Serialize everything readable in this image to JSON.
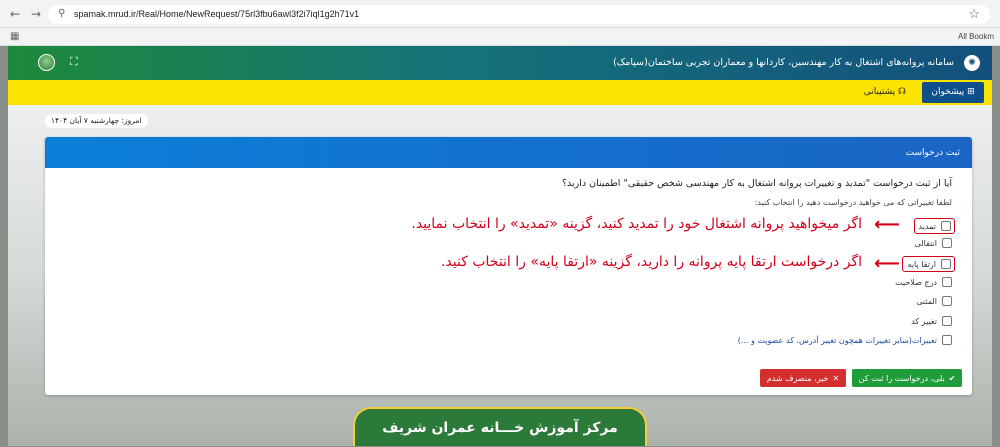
{
  "browser": {
    "url": "spamak.mrud.ir/Real/Home/NewRequest/75rl3fbu6awl3f2i7iql1g2h71v1",
    "bookmarks_label": "All Bookm"
  },
  "header": {
    "title": "سامانه پروانه‌های اشتغال به کار مهندسین، کاردانها و معماران تجربی ساختمان(سپامک)"
  },
  "toolbar": {
    "dashboard_label": "پیشخوان",
    "support_label": "پشتیبانی"
  },
  "date_text": "امروز: چهارشنبه ۷ آبان ۱۴۰۴",
  "card": {
    "title": "ثبت درخواست",
    "question": "آیا از ثبت درخواست \"تمدید و تغییرات پروانه اشتغال به کار مهندسی شخص حقیقی\" اطمینان دارید؟",
    "instruction": "لطفا تغییراتی که می خواهید درخواست دهید را انتخاب کنید:",
    "options": [
      {
        "label": "تمدید",
        "checked": false
      },
      {
        "label": "انتقالی",
        "checked": false
      },
      {
        "label": "ارتقا پایه",
        "checked": false
      },
      {
        "label": "درج صلاحیت",
        "checked": false
      },
      {
        "label": "المثنی",
        "checked": false
      },
      {
        "label": "تغییر کد",
        "checked": false
      },
      {
        "label": "تغییرات(سایر تغییرات همچون تغییر آدرس، کد عضویت و ...)",
        "checked": false
      }
    ],
    "yes_button": "بلی، درخواست را ثبت کن",
    "no_button": "خیر، منصرف شدم"
  },
  "annotations": {
    "renew_note": "اگر میخواهید پروانه اشتغال خود را تمدید کنید، گزینه «تمدید» را انتخاب نمایید.",
    "upgrade_note": "اگر درخواست ارتقا پایه پروانه را دارید، گزینه «ارتقا پایه» را انتخاب کنید."
  },
  "footer_badge": "مرکز آموزش خـــانه عمران شریف",
  "colors": {
    "header_start": "#1d8a3a",
    "header_end": "#13507d",
    "yellow_bar": "#fce401",
    "card_header": "#0b7fd8",
    "annotation_red": "#d4001a",
    "yes_green": "#1f9d3a",
    "no_red": "#d32f2f"
  }
}
